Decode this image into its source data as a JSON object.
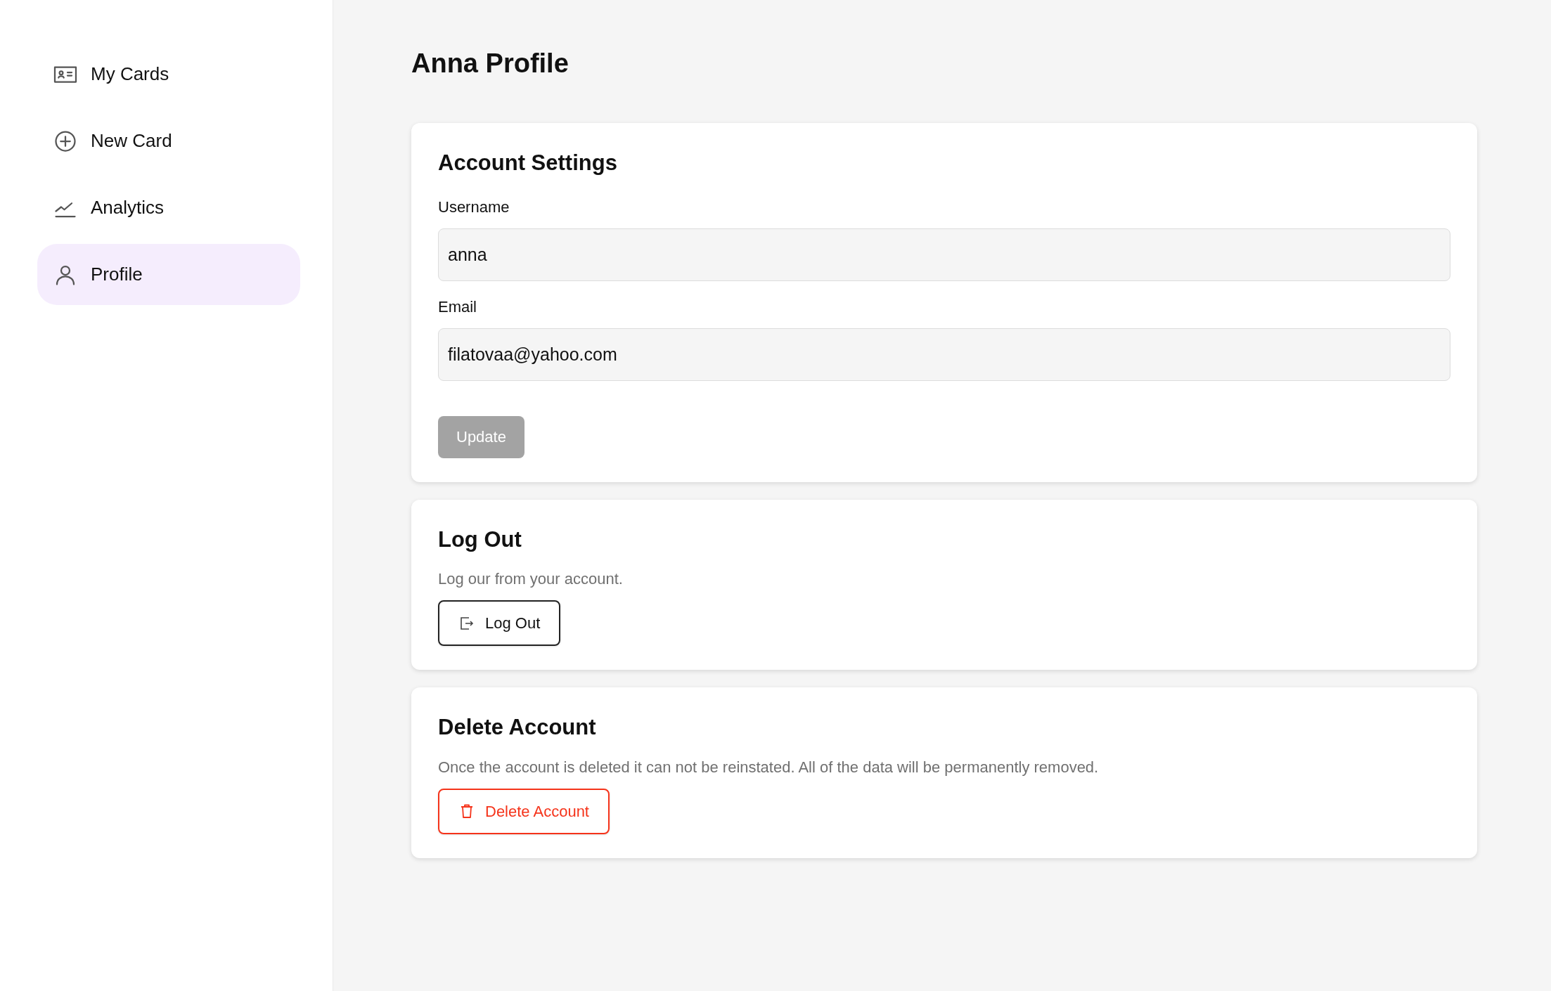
{
  "sidebar": {
    "items": [
      {
        "label": "My Cards",
        "selected": false
      },
      {
        "label": "New Card",
        "selected": false
      },
      {
        "label": "Analytics",
        "selected": false
      },
      {
        "label": "Profile",
        "selected": true
      }
    ]
  },
  "page_title": "Anna Profile",
  "account_settings": {
    "title": "Account Settings",
    "fields": [
      {
        "label": "Username",
        "value": "anna"
      },
      {
        "label": "Email",
        "value": "filatovaa@yahoo.com"
      }
    ],
    "update_button": {
      "label": "Update",
      "disabled": true
    }
  },
  "log_out": {
    "title": "Log Out",
    "description": "Log our from your account.",
    "button": "Log Out"
  },
  "delete_account": {
    "title": "Delete Account",
    "description": "Once the account is deleted it can not be reinstated. All of the data will be permanently removed.",
    "button": "Delete Account"
  }
}
